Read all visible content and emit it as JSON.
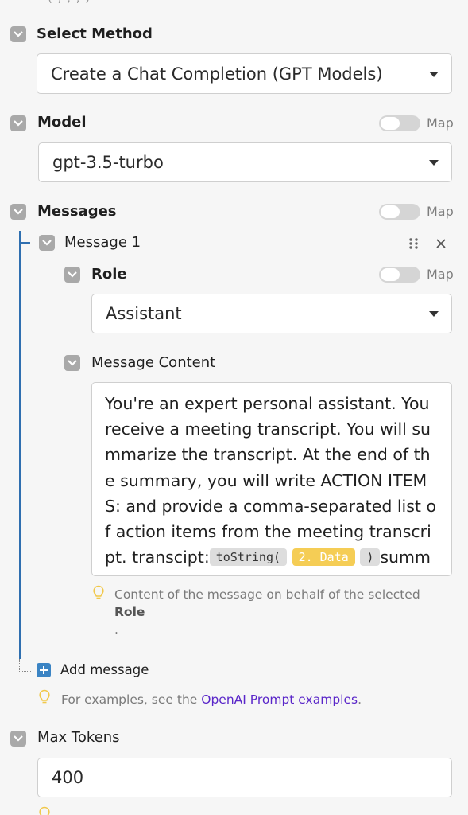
{
  "select_method": {
    "label": "Select Method",
    "value": "Create a Chat Completion (GPT Models)"
  },
  "model": {
    "label": "Model",
    "map_label": "Map",
    "value": "gpt-3.5-turbo"
  },
  "messages": {
    "label": "Messages",
    "map_label": "Map",
    "message_1": {
      "label": "Message 1",
      "role": {
        "label": "Role",
        "map_label": "Map",
        "value": "Assistant"
      },
      "content": {
        "label": "Message Content",
        "text": "You're an expert personal assistant. You receive a meeting transcript. You will summarize the transcript. At the end of the summary, you will write ACTION ITEMS: and provide a comma-separated list of action items from the meeting transcript.",
        "prefix": "transcipt:",
        "fn_open": "toString(",
        "var": "2. Data",
        "fn_close": ")",
        "suffix": "summery",
        "hint_text": "Content of the message on behalf of the selected",
        "hint_bold": "Role",
        "hint_end": "."
      }
    },
    "add_label": "Add message",
    "examples_hint_pre": "For examples, see the",
    "examples_link": "OpenAI Prompt examples",
    "examples_hint_post": "."
  },
  "max_tokens": {
    "label": "Max Tokens",
    "value": "400"
  },
  "icons": [
    "checkbox-icon",
    "caret-down-icon",
    "drag-handle-icon",
    "close-icon",
    "plus-icon",
    "lightbulb-icon"
  ],
  "colors": {
    "link": "#5a26c9",
    "plus_button": "#3b84c4",
    "tree_line": "#2f6fb0",
    "variable_pill": "#f5cd55"
  }
}
